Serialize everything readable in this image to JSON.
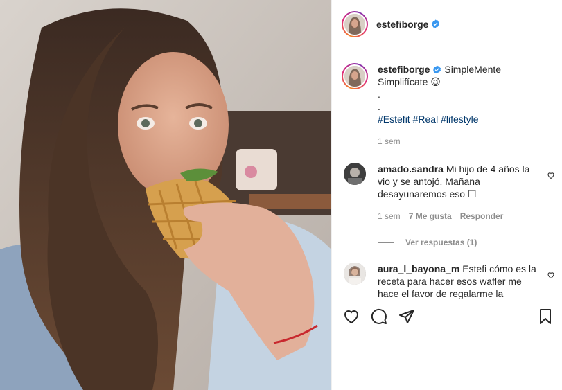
{
  "post": {
    "username": "estefiborge"
  },
  "caption": {
    "username": "estefiborge",
    "text": "SimpleMente Simplifícate",
    "emoji": "😉",
    "dot1": ".",
    "dot2": ".",
    "hashtags": [
      "#Estefit",
      "#Real",
      "#lifestyle"
    ],
    "time": "1 sem"
  },
  "comments": [
    {
      "username": "amado.sandra",
      "text": "Mi hijo de 4 años la vio y se antojó. Mañana desayunaremos eso ☐",
      "time": "1 sem",
      "likes": "7 Me gusta",
      "reply": "Responder"
    },
    {
      "username": "aura_l_bayona_m",
      "text": "Estefi cómo es la receta para hacer esos wafler me hace el favor de regalarme la"
    }
  ],
  "view_replies": "Ver respuestas (1)",
  "icons": {
    "like": "heart-icon",
    "comment": "comment-icon",
    "share": "paper-plane-icon",
    "save": "bookmark-icon",
    "verified": "verified-badge-icon"
  },
  "colors": {
    "verified": "#3897f0",
    "hashtag": "#00376b",
    "muted": "#8e8e8e"
  }
}
